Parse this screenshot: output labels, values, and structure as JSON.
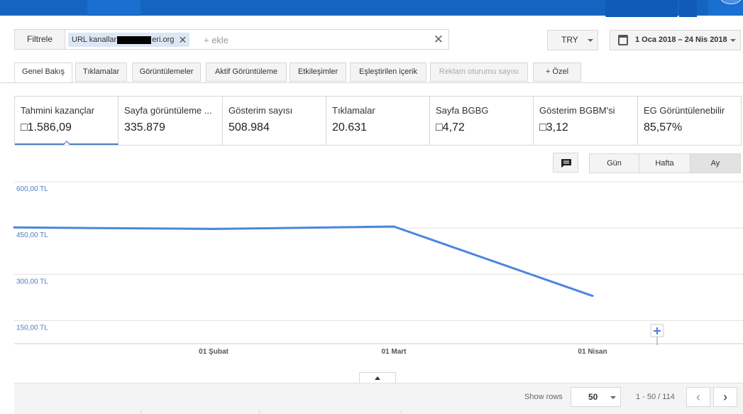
{
  "filter": {
    "label": "Filtrele",
    "chip_prefix": "URL kanallar",
    "chip_suffix": "eri.org",
    "add_placeholder": "+ ekle"
  },
  "currency": {
    "value": "TRY"
  },
  "date_range": {
    "value": "1 Oca 2018 – 24 Nis 2018"
  },
  "tabs": [
    {
      "label": "Genel Bakış",
      "active": true
    },
    {
      "label": "Tıklamalar"
    },
    {
      "label": "Görüntülemeler"
    },
    {
      "label": "Aktif Görüntüleme"
    },
    {
      "label": "Etkileşimler"
    },
    {
      "label": "Eşleştirilen içerik"
    },
    {
      "label": "Reklam oturumu sayısı",
      "disabled": true
    },
    {
      "label": "+ Özel"
    }
  ],
  "metrics": [
    {
      "label": "Tahmini kazançlar",
      "value": "□1.586,09",
      "active": true
    },
    {
      "label": "Sayfa görüntüleme ...",
      "value": "335.879"
    },
    {
      "label": "Gösterim sayısı",
      "value": "508.984"
    },
    {
      "label": "Tıklamalar",
      "value": "20.631"
    },
    {
      "label": "Sayfa BGBG",
      "value": "□4,72"
    },
    {
      "label": "Gösterim BGBM'si",
      "value": "□3,12"
    },
    {
      "label": "EG Görüntülenebilir",
      "value": "85,57%"
    }
  ],
  "period": {
    "day": "Gün",
    "week": "Hafta",
    "month": "Ay",
    "selected": "Ay"
  },
  "icons": {
    "annotation": "comment-icon",
    "calendar": "calendar-icon",
    "add_annotation": "plus-icon"
  },
  "colors": {
    "series": "#4a87dc",
    "brand": "#1565c0",
    "axis_label": "#4a7fc1"
  },
  "chart_data": {
    "type": "line",
    "title": "",
    "ylabel": "",
    "xlabel": "",
    "ylim": [
      75,
      600
    ],
    "yticks": [
      {
        "value": 600,
        "label": "600,00 TL"
      },
      {
        "value": 450,
        "label": "450,00 TL"
      },
      {
        "value": 300,
        "label": "300,00 TL"
      },
      {
        "value": 150,
        "label": "150,00 TL"
      }
    ],
    "xticks": [
      "01 Şubat",
      "01 Mart",
      "01 Nisan"
    ],
    "series": [
      {
        "x": [
          "2018-01",
          "2018-02",
          "2018-03",
          "2018-04"
        ],
        "values": [
          452,
          447,
          455,
          230
        ]
      }
    ],
    "grid": true
  },
  "pager": {
    "show_rows_label": "Show rows",
    "rows": "50",
    "range": "1 - 50 / 114",
    "prev": "‹",
    "next": "›"
  }
}
